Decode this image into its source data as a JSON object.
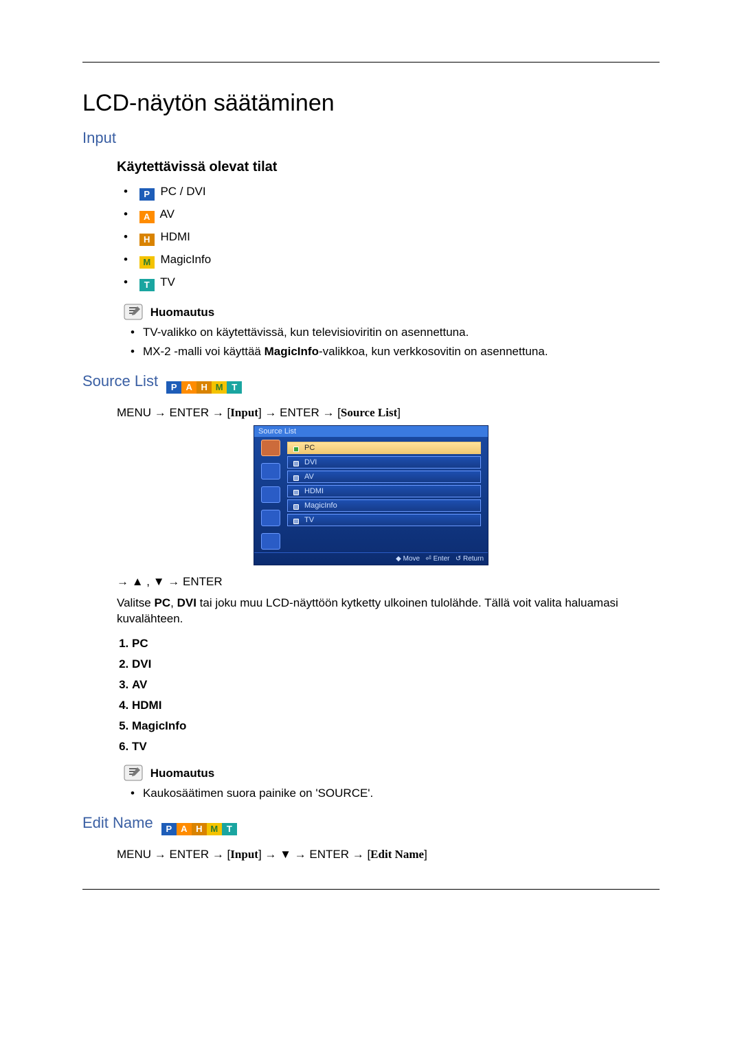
{
  "title": "LCD-näytön säätäminen",
  "section1": {
    "heading": "Input",
    "subheading": "Käytettävissä olevat tilat",
    "modes": [
      {
        "badge": "P",
        "label": "PC / DVI"
      },
      {
        "badge": "A",
        "label": "AV"
      },
      {
        "badge": "H",
        "label": "HDMI"
      },
      {
        "badge": "M",
        "label": "MagicInfo"
      },
      {
        "badge": "T",
        "label": "TV"
      }
    ],
    "note_label": "Huomautus",
    "notes": [
      "TV-valikko on käytettävissä, kun televisioviritin on asennettuna.",
      "MX-2 -malli voi käyttää MagicInfo-valikkoa, kun verkkosovitin on asennettuna."
    ]
  },
  "section2": {
    "heading": "Source List",
    "nav": {
      "parts": [
        "MENU",
        "ENTER",
        "Input",
        "ENTER",
        "Source List"
      ]
    },
    "osd": {
      "title": "Source List",
      "items": [
        "PC",
        "DVI",
        "AV",
        "HDMI",
        "MagicInfo",
        "TV"
      ],
      "selected_index": 0,
      "footer": {
        "move": "Move",
        "enter": "Enter",
        "return": "Return"
      }
    },
    "nav2": "→ ▲ , ▼ → ENTER",
    "body_pre": "Valitse ",
    "body_bold1": "PC",
    "body_mid": ", ",
    "body_bold2": "DVI",
    "body_post": " tai joku muu LCD-näyttöön kytketty ulkoinen tulolähde. Tällä voit valita haluamasi kuvalähteen.",
    "numlist": [
      "PC",
      "DVI",
      "AV",
      "HDMI",
      "MagicInfo",
      "TV"
    ],
    "note_label": "Huomautus",
    "notes": [
      "Kaukosäätimen suora painike on 'SOURCE'."
    ]
  },
  "section3": {
    "heading": "Edit Name",
    "nav": {
      "parts": [
        "MENU",
        "ENTER",
        "Input",
        "▼",
        "ENTER",
        "Edit Name"
      ]
    }
  }
}
